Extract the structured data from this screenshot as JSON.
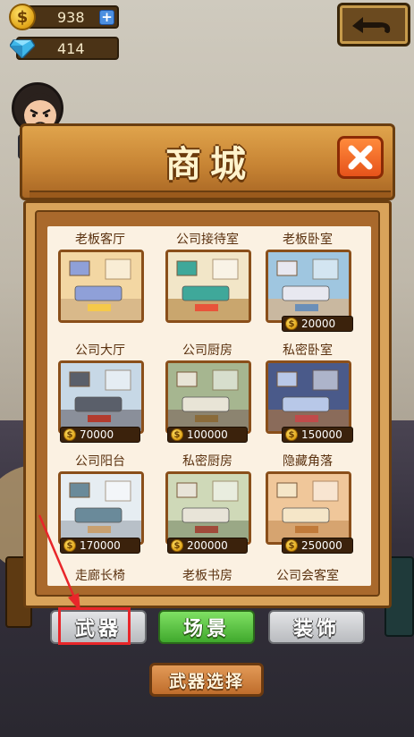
{
  "currency": {
    "coins": "938",
    "gems": "414",
    "coin_symbol": "$",
    "plus": "+"
  },
  "dialog": {
    "title": "商城"
  },
  "shop_items": [
    {
      "name": "老板客厅",
      "price": null
    },
    {
      "name": "公司接待室",
      "price": null
    },
    {
      "name": "老板卧室",
      "price": "20000"
    },
    {
      "name": "公司大厅",
      "price": "70000"
    },
    {
      "name": "公司厨房",
      "price": "100000"
    },
    {
      "name": "私密卧室",
      "price": "150000"
    },
    {
      "name": "公司阳台",
      "price": "170000"
    },
    {
      "name": "私密厨房",
      "price": "200000"
    },
    {
      "name": "隐藏角落",
      "price": "250000"
    },
    {
      "name": "走廊长椅",
      "price": null
    },
    {
      "name": "老板书房",
      "price": null
    },
    {
      "name": "公司会客室",
      "price": null
    }
  ],
  "tabs": {
    "weapon": "武器",
    "scene": "场景",
    "decor": "装饰"
  },
  "weapon_select": "武器选择",
  "colors": {
    "active_tab": "#40a92d",
    "highlight": "#e8262a",
    "wood": "#c78434"
  }
}
